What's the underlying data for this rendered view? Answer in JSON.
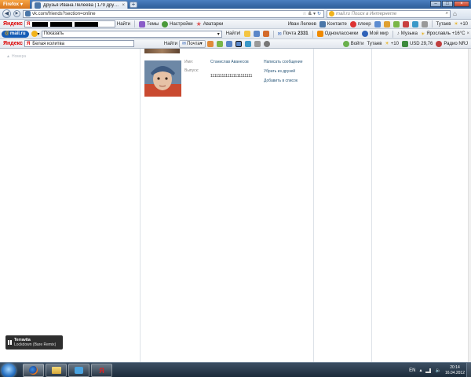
{
  "browser": {
    "menu_label": "Firefox",
    "tab_title": "Друзья Ивана Лелеева | 179 друзей онл...",
    "url": "vk.com/friends?section=online",
    "search_placeholder": "mail.ru Поиск в Интернете"
  },
  "yandex_bar": {
    "logo": "Яндекс",
    "find_label": "Найти",
    "themes_label": "Темы",
    "settings_label": "Настройки",
    "avatars_label": "Аватарки",
    "user_label": "Иван Лелеев",
    "vk_label": "Контакте",
    "player_label": "плеер",
    "city_label": "Тутаев",
    "temp_label": "+10"
  },
  "mailru_bar": {
    "logo": "mail.ru",
    "search_value": "Показать",
    "find_label": "Найти!",
    "mail_label": "Почта",
    "mail_count": "2331",
    "ok_label": "Одноклассники",
    "myworld_label": "Мой мир",
    "music_label": "Музыка",
    "weather_label": "Ярославль +16°С"
  },
  "bar3": {
    "logo": "Яндекс",
    "search_value": "Белая колитва",
    "find_label": "Найти",
    "mail_label": "Почта",
    "login_label": "Войти",
    "city_label": "Тутаев",
    "temp_label": "+10",
    "usd_label": "USD 29,76",
    "radio_label": "Радио NRJ"
  },
  "page": {
    "left_label": "Номера",
    "friend": {
      "name_label": "Имя:",
      "name": "Станислав Аванесов",
      "grad_label": "Выпуск:",
      "grad_value": "1111111111111111111111",
      "actions": [
        "Написать сообщение",
        "Убрать из друзей",
        "Добавить в список"
      ]
    }
  },
  "media": {
    "title": "Terravita",
    "subtitle": "Lockdown (Bare Remix)"
  },
  "taskbar": {
    "language": "EN",
    "time": "20:14",
    "date": "16.04.2012"
  },
  "colors": {
    "accent_link": "#2b587a",
    "taskbar": "#1c2b3a",
    "firefox_button": "#e88a2a",
    "mailru_blue": "#165cb5"
  }
}
